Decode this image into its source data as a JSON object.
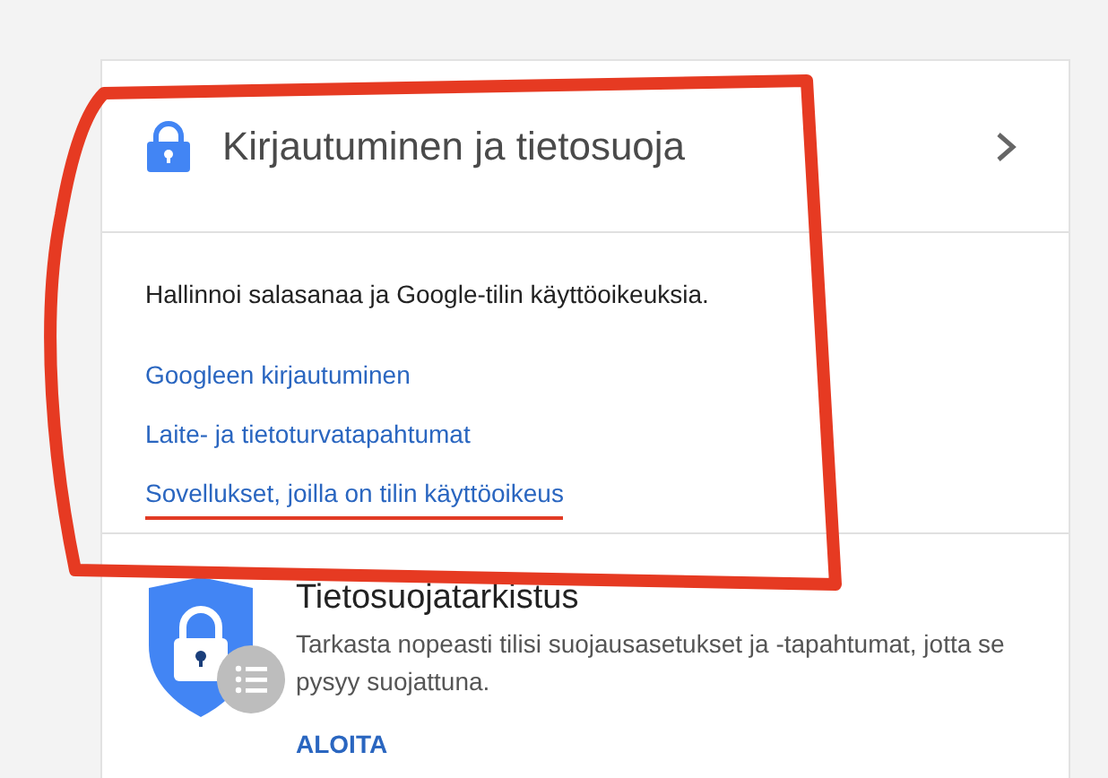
{
  "annotation_outline": true,
  "signin_card": {
    "title": "Kirjautuminen ja tietosuoja",
    "description": "Hallinnoi salasanaa ja Google-tilin käyttöoikeuksia.",
    "links": [
      {
        "label": "Googleen kirjautuminen",
        "underlined": false
      },
      {
        "label": "Laite- ja tietoturvatapahtumat",
        "underlined": false
      },
      {
        "label": "Sovellukset, joilla on tilin käyttöoikeus",
        "underlined": true
      }
    ]
  },
  "privacy_check": {
    "title": "Tietosuojatarkistus",
    "description": "Tarkasta nopeasti tilisi suojausasetukset ja -tapahtumat, jotta se pysyy suojattuna.",
    "action": "ALOITA"
  }
}
